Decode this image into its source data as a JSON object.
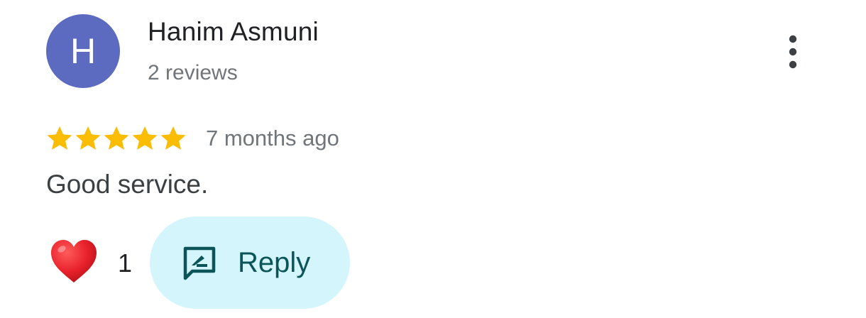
{
  "author": {
    "initial": "H",
    "name": "Hanim Asmuni",
    "meta": "2 reviews",
    "avatar_color": "#5c6bc0"
  },
  "menu": {
    "icon": "more-vertical-icon"
  },
  "review": {
    "rating": 5,
    "max_rating": 5,
    "star_color": "#fbbc04",
    "timestamp": "7 months ago",
    "text": "Good service."
  },
  "reactions": {
    "icon": "heart-icon",
    "count": "1"
  },
  "reply": {
    "icon": "reply-icon",
    "label": "Reply",
    "background": "#d3f5fb",
    "color": "#0b5559"
  }
}
